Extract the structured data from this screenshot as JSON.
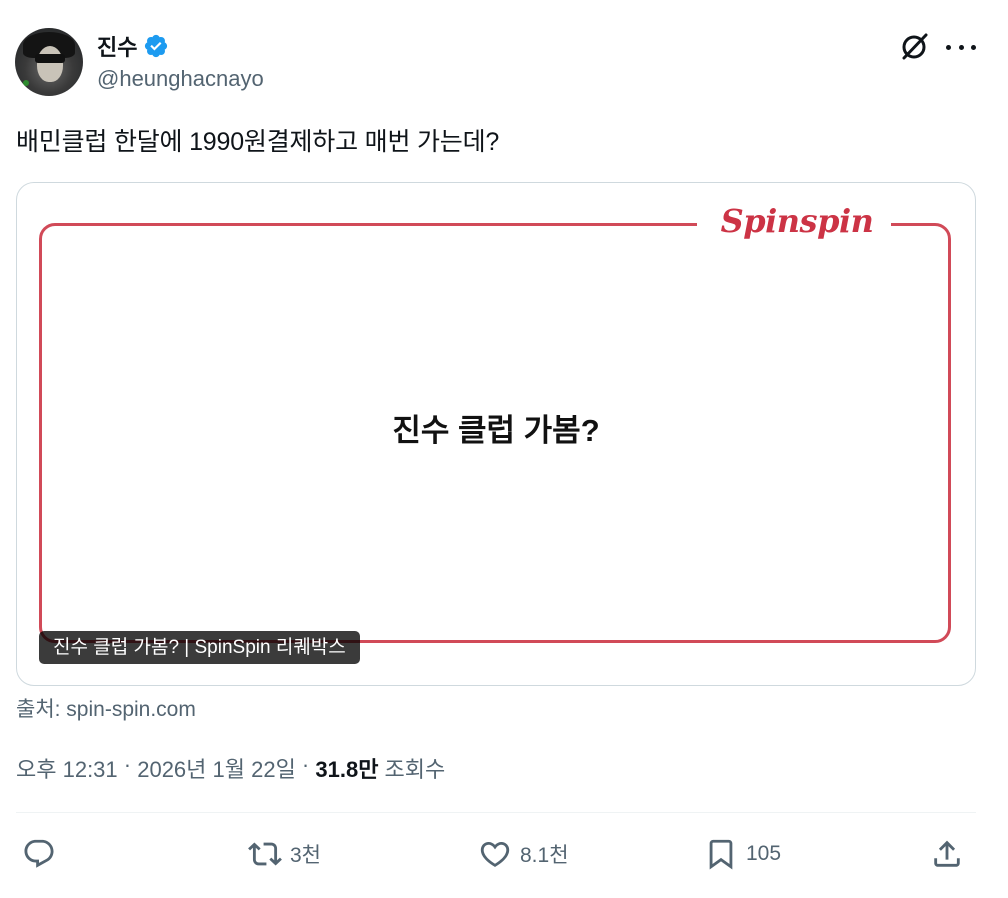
{
  "author": {
    "display_name": "진수",
    "handle": "@heunghacnayo",
    "verified": true
  },
  "tweet": {
    "text": "배민클럽 한달에 1990원결제하고 매번 가는데?"
  },
  "card": {
    "logo_text": "Spinspin",
    "headline": "진수 클럽 가봄?",
    "caption": "진수 클럽 가봄? | SpinSpin 리퀘박스",
    "accent_color": "#d14a58"
  },
  "source": "출처: spin-spin.com",
  "meta": {
    "time": "오후 12:31",
    "sep1": " · ",
    "date": "2026년 1월 22일",
    "sep2": " · ",
    "views_count": "31.8만",
    "views_label": " 조회수"
  },
  "actions": {
    "reply_count": "",
    "retweet_count": "3천",
    "like_count": "8.1천",
    "bookmark_count": "105"
  },
  "icons": {
    "verified": "verified-badge-icon",
    "grok": "grok-icon",
    "more": "more-icon",
    "reply": "reply-icon",
    "retweet": "retweet-icon",
    "like": "heart-icon",
    "bookmark": "bookmark-icon",
    "share": "share-icon"
  }
}
